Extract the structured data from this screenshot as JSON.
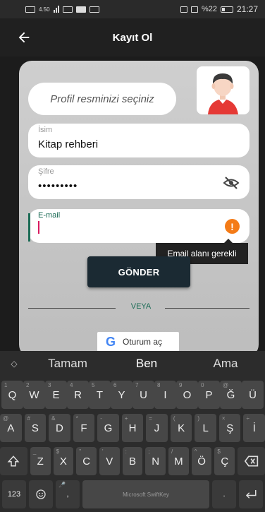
{
  "status_bar": {
    "network": "4.50",
    "battery_percent": "%22",
    "time": "21:27"
  },
  "app_bar": {
    "title": "Kayıt Ol",
    "back_icon": "arrow-left-icon"
  },
  "form": {
    "photo_prompt": "Profil resminizi seçiniz",
    "name": {
      "label": "İsim",
      "value": "Kitap rehberi"
    },
    "password": {
      "label": "Şifre",
      "value": "•••••••••"
    },
    "email": {
      "label": "E-mail",
      "value": "",
      "error": "Email alanı gerekli"
    },
    "submit_label": "GÖNDER",
    "divider_text": "VEYA",
    "google_label": "Oturum aç"
  },
  "colors": {
    "accent": "#1b6b55",
    "error": "#f47b17",
    "button": "#1b2a33"
  },
  "keyboard": {
    "suggestions": [
      "Tamam",
      "Ben",
      "Ama"
    ],
    "row1": [
      {
        "k": "Q",
        "h": "1"
      },
      {
        "k": "W",
        "h": "2"
      },
      {
        "k": "E",
        "h": "3"
      },
      {
        "k": "R",
        "h": "4"
      },
      {
        "k": "T",
        "h": "5"
      },
      {
        "k": "Y",
        "h": "6"
      },
      {
        "k": "U",
        "h": "7"
      },
      {
        "k": "I",
        "h": "8"
      },
      {
        "k": "O",
        "h": "9"
      },
      {
        "k": "P",
        "h": "0"
      },
      {
        "k": "Ğ",
        "h": "@"
      },
      {
        "k": "Ü",
        "h": ""
      }
    ],
    "row2": [
      {
        "k": "A",
        "h": "@"
      },
      {
        "k": "S",
        "h": "#"
      },
      {
        "k": "D",
        "h": "&"
      },
      {
        "k": "F",
        "h": "*"
      },
      {
        "k": "G",
        "h": "-"
      },
      {
        "k": "H",
        "h": "+"
      },
      {
        "k": "J",
        "h": "="
      },
      {
        "k": "K",
        "h": "("
      },
      {
        "k": "L",
        "h": ")"
      },
      {
        "k": "Ş",
        "h": "×"
      },
      {
        "k": "İ",
        "h": "÷"
      }
    ],
    "row3": [
      {
        "k": "Z",
        "h": "_"
      },
      {
        "k": "X",
        "h": "$"
      },
      {
        "k": "C",
        "h": "\""
      },
      {
        "k": "V",
        "h": "'"
      },
      {
        "k": "B",
        "h": ":"
      },
      {
        "k": "N",
        "h": ";"
      },
      {
        "k": "M",
        "h": "/"
      },
      {
        "k": "Ö",
        "h": "^"
      },
      {
        "k": "Ç",
        "h": "$"
      }
    ],
    "mode_label": "123",
    "space_label": "Microsoft SwiftKey",
    "comma": ",",
    "period": "."
  }
}
